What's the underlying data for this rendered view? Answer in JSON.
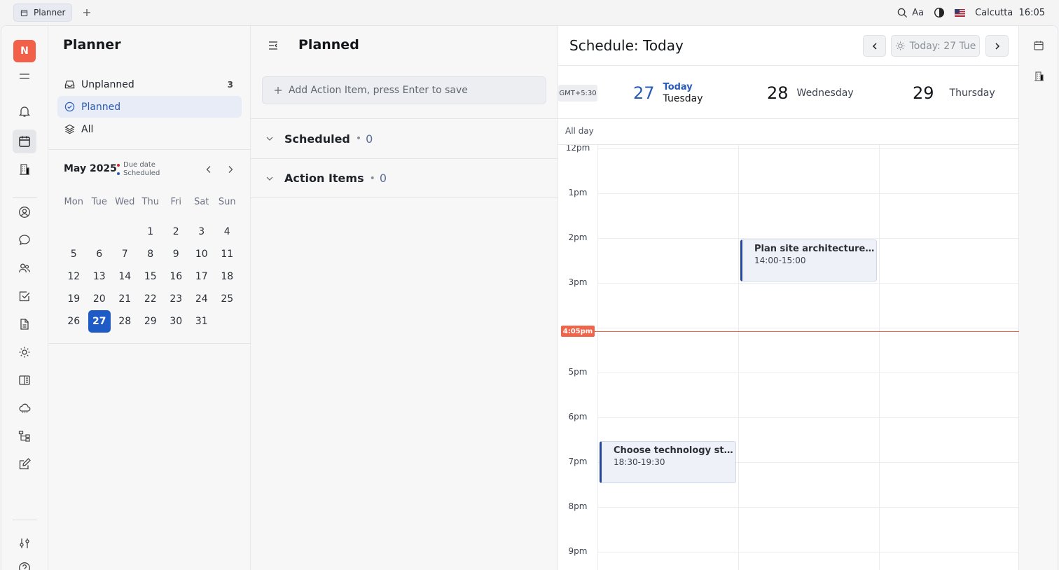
{
  "topbar": {
    "tab_label": "Planner",
    "font_label": "Aa",
    "location": "Calcutta",
    "time": "16:05"
  },
  "rail": {
    "avatar_letter": "N",
    "accent": "#f2604a"
  },
  "nav": {
    "title": "Planner",
    "items": [
      {
        "label": "Unplanned",
        "count": "3",
        "icon": "inbox-icon"
      },
      {
        "label": "Planned",
        "count": "",
        "icon": "check-circle-icon"
      },
      {
        "label": "All",
        "count": "",
        "icon": "layers-icon"
      }
    ]
  },
  "calendar": {
    "month": "May 2025",
    "legend_due": "Due date",
    "legend_scheduled": "Scheduled",
    "due_color": "#d1242f",
    "scheduled_color": "#2a5bb8",
    "weekdays": [
      "Mon",
      "Tue",
      "Wed",
      "Thu",
      "Fri",
      "Sat",
      "Sun"
    ],
    "weeks": [
      [
        "",
        "",
        "",
        "1",
        "2",
        "3",
        "4"
      ],
      [
        "5",
        "6",
        "7",
        "8",
        "9",
        "10",
        "11"
      ],
      [
        "12",
        "13",
        "14",
        "15",
        "16",
        "17",
        "18"
      ],
      [
        "19",
        "20",
        "21",
        "22",
        "23",
        "24",
        "25"
      ],
      [
        "26",
        "27",
        "28",
        "29",
        "30",
        "31",
        ""
      ]
    ],
    "today": "27"
  },
  "planned": {
    "title": "Planned",
    "add_placeholder": "Add Action Item, press Enter to save",
    "sections": [
      {
        "label": "Scheduled",
        "count": "0"
      },
      {
        "label": "Action Items",
        "count": "0"
      }
    ]
  },
  "schedule": {
    "title": "Schedule: Today",
    "today_button": "Today: 27 Tue",
    "timezone": "GMT+5:30",
    "days": [
      {
        "num": "27",
        "today_label": "Today",
        "name": "Tuesday"
      },
      {
        "num": "28",
        "name": "Wednesday"
      },
      {
        "num": "29",
        "name": "Thursday"
      }
    ],
    "all_day": "All day",
    "hours": [
      "12pm",
      "1pm",
      "2pm",
      "3pm",
      "",
      "5pm",
      "6pm",
      "7pm",
      "8pm",
      "9pm"
    ],
    "now_label": "4:05pm",
    "now_color": "#f06449",
    "events": [
      {
        "title": "Plan site architecture an...",
        "time": "14:00-15:00",
        "day": 1,
        "start": 14,
        "end": 15
      },
      {
        "title": "Choose technology stack ...",
        "time": "18:30-19:30",
        "day": 0,
        "start": 18.5,
        "end": 19.5
      }
    ]
  }
}
